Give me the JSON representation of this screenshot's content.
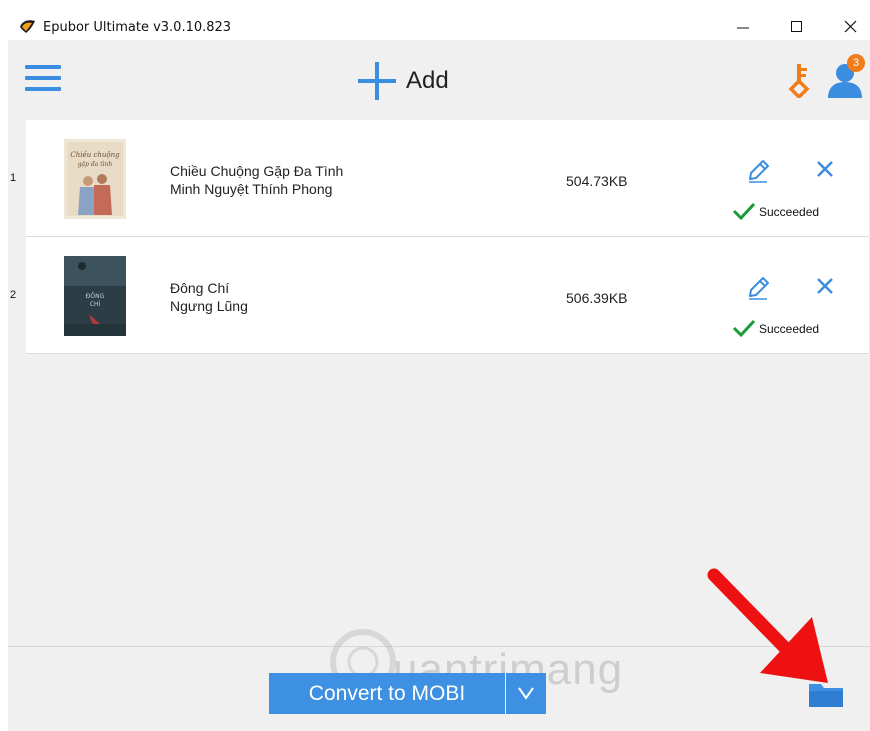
{
  "window": {
    "title": "Epubor Ultimate v3.0.10.823",
    "minimize_icon": "minimize-icon",
    "maximize_icon": "maximize-icon",
    "close_icon": "close-icon"
  },
  "toolbar": {
    "menu_icon": "hamburger-menu-icon",
    "add_label": "Add",
    "add_icon": "plus-icon",
    "key_icon": "key-icon",
    "user_icon": "user-icon",
    "notification_count": "3",
    "accent_color": "#3b8de0",
    "orange_color": "#f07d1a"
  },
  "books": [
    {
      "index": "1",
      "title": "Chiều Chuộng Gặp Đa Tình",
      "author": "Minh Nguyệt Thính Phong",
      "size": "504.73KB",
      "status": "Succeeded"
    },
    {
      "index": "2",
      "title": "Đông Chí",
      "author": "Ngưng Lũng",
      "size": "506.39KB",
      "status": "Succeeded"
    }
  ],
  "footer": {
    "convert_label": "Convert to MOBI",
    "dropdown_icon": "chevron-down-icon",
    "folder_icon": "folder-icon",
    "watermark_text": "uantrimang"
  },
  "colors": {
    "success_green": "#1a9b3a",
    "button_blue": "#3e90e2",
    "annotation_red": "#ee1111"
  }
}
